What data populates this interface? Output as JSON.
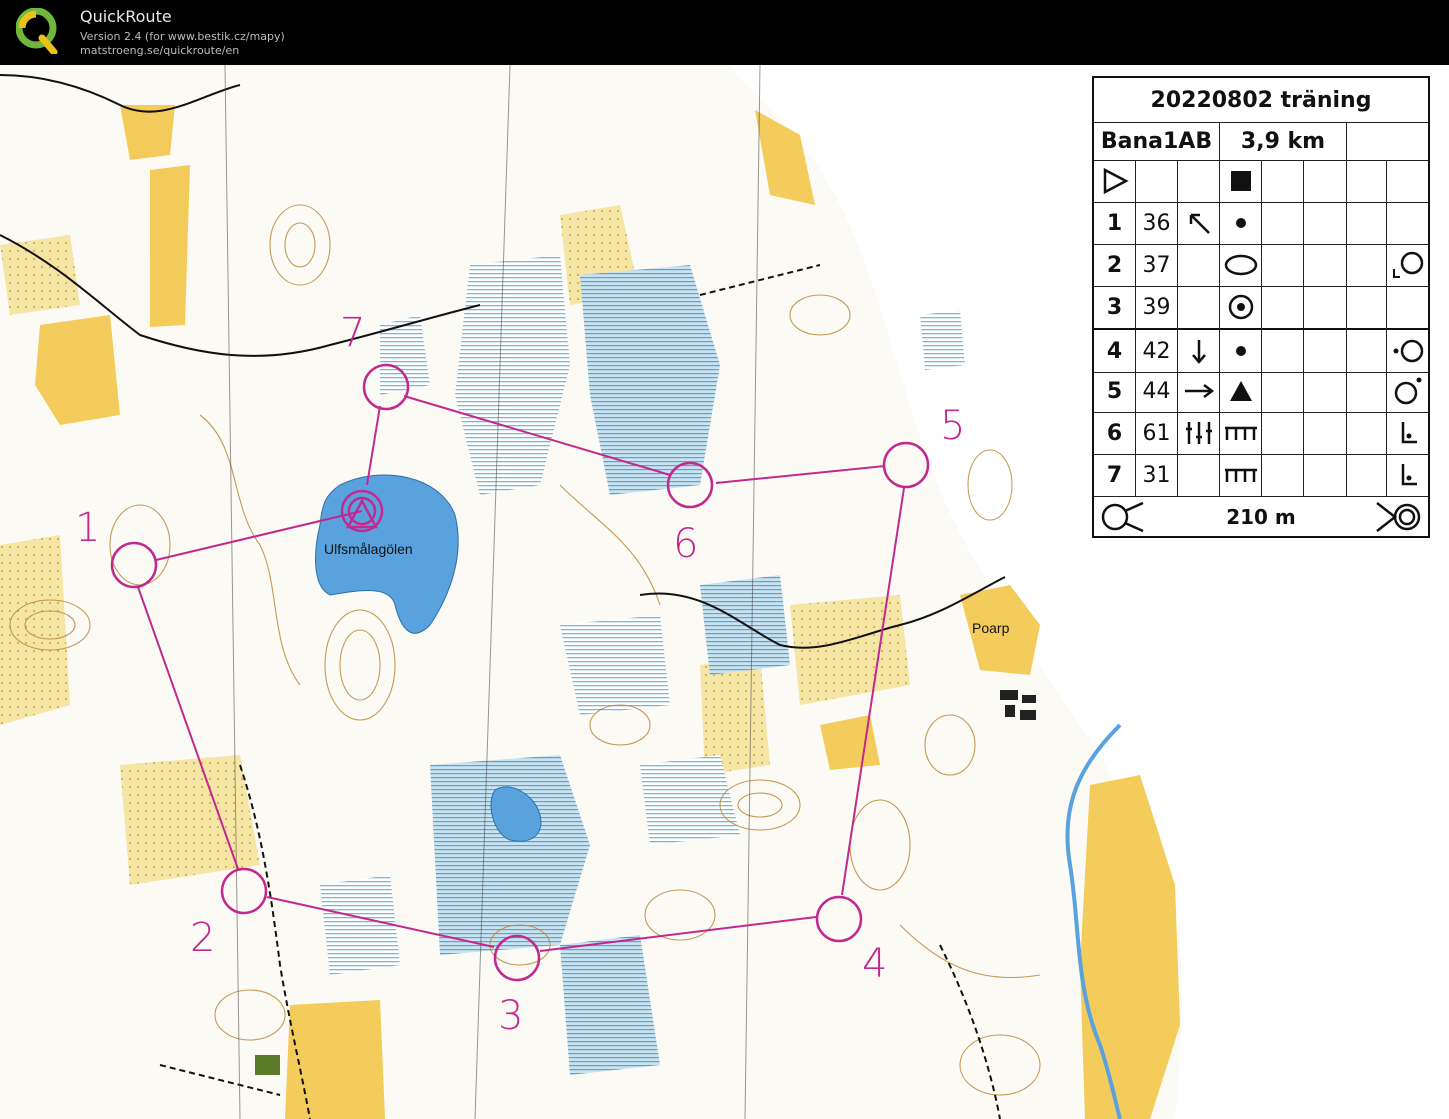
{
  "app": {
    "name": "QuickRoute",
    "version": "Version 2.4  (for www.bestik.cz/mapy)",
    "url": "matstroeng.se/quickroute/en"
  },
  "map": {
    "lake_label": "Ulfsmålagölen",
    "place_label": "Poarp",
    "controls": [
      "1",
      "2",
      "3",
      "4",
      "5",
      "6",
      "7"
    ]
  },
  "description": {
    "event": "20220802 träning",
    "course": "Bana1AB",
    "length": "3,9 km",
    "rows": [
      {
        "no": "1",
        "code": "36"
      },
      {
        "no": "2",
        "code": "37"
      },
      {
        "no": "3",
        "code": "39"
      },
      {
        "no": "4",
        "code": "42"
      },
      {
        "no": "5",
        "code": "44"
      },
      {
        "no": "6",
        "code": "61"
      },
      {
        "no": "7",
        "code": "31"
      }
    ],
    "finish_distance": "210 m"
  },
  "colors": {
    "course": "#c2298f",
    "water": "#a9d2ea",
    "lake": "#5aa2de",
    "open": "#f3c74a",
    "contour": "#b98b3a"
  }
}
